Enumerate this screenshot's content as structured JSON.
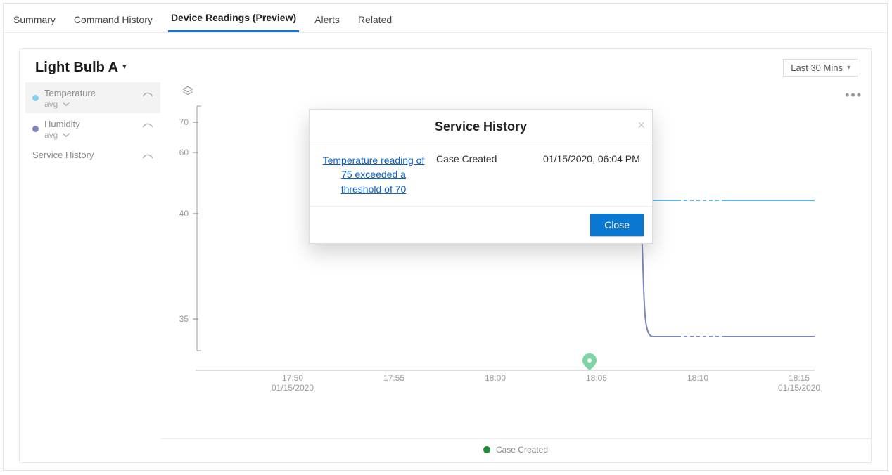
{
  "tabs": [
    {
      "label": "Summary",
      "active": false
    },
    {
      "label": "Command History",
      "active": false
    },
    {
      "label": "Device Readings (Preview)",
      "active": true
    },
    {
      "label": "Alerts",
      "active": false
    },
    {
      "label": "Related",
      "active": false
    }
  ],
  "device_title": "Light Bulb A",
  "range_selector": "Last 30 Mins",
  "side_legend": [
    {
      "label": "Temperature",
      "agg": "avg",
      "color": "#85cef1",
      "selected": true
    },
    {
      "label": "Humidity",
      "agg": "avg",
      "color": "#7b87bd",
      "selected": false
    },
    {
      "label": "Service History",
      "agg": "",
      "color": "",
      "selected": false
    }
  ],
  "bottom_legend": "Case Created",
  "modal": {
    "title": "Service History",
    "rows": [
      {
        "link": "Temperature reading of 75 exceeded a threshold of 70",
        "type": "Case Created",
        "date": "01/15/2020, 06:04 PM"
      }
    ],
    "close": "Close"
  },
  "chart_data": {
    "type": "line",
    "xlabel": "",
    "ylabel": "",
    "x_ticks": [
      "17:50",
      "17:55",
      "18:00",
      "18:05",
      "18:10",
      "18:15"
    ],
    "x_date_start": "01/15/2020",
    "x_date_end": "01/15/2020",
    "y_ticks_upper": [
      40,
      60,
      70
    ],
    "y_ticks_lower": [
      35
    ],
    "series": [
      {
        "name": "Temperature avg",
        "color": "#69b9e6",
        "segments": [
          {
            "x_start": "18:07",
            "x_end": "18:09",
            "value": 45,
            "style": "solid"
          },
          {
            "x_start": "18:09",
            "x_end": "18:11",
            "value": 45,
            "style": "dashed"
          },
          {
            "x_start": "18:11",
            "x_end": "18:15",
            "value": 45,
            "style": "solid"
          }
        ]
      },
      {
        "name": "Humidity avg",
        "color": "#7b87bd",
        "segments": [
          {
            "x_start": "18:07",
            "x_end": "18:07",
            "value_from": 45,
            "value_to": 34,
            "style": "solid"
          },
          {
            "x_start": "18:07",
            "x_end": "18:09",
            "value": 34,
            "style": "solid"
          },
          {
            "x_start": "18:09",
            "x_end": "18:11",
            "value": 34,
            "style": "dashed"
          },
          {
            "x_start": "18:11",
            "x_end": "18:15",
            "value": 34,
            "style": "solid"
          }
        ]
      }
    ],
    "events": [
      {
        "label": "Case Created",
        "x": "18:04",
        "color": "#7ed4a7"
      }
    ]
  }
}
